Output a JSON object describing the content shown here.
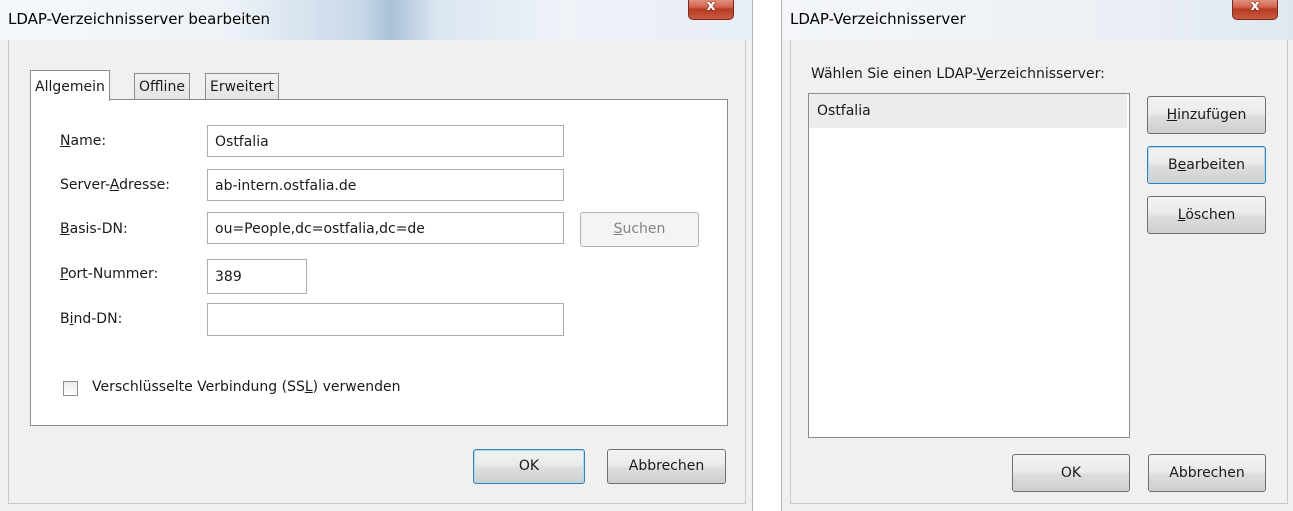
{
  "edit_dialog": {
    "title": "LDAP-Verzeichnisserver bearbeiten",
    "close_glyph": "x",
    "tabs": [
      {
        "label": "Allgemein",
        "active": true
      },
      {
        "label": "Offline",
        "active": false
      },
      {
        "label": "Erweitert",
        "active": false
      }
    ],
    "fields": {
      "name": {
        "label_u": "N",
        "label_rest": "ame:",
        "value": "Ostfalia"
      },
      "server": {
        "label_pre": "Server-",
        "label_u": "A",
        "label_rest": "dresse:",
        "value": "ab-intern.ostfalia.de"
      },
      "basedn": {
        "label_u": "B",
        "label_rest": "asis-DN:",
        "value": "ou=People,dc=ostfalia,dc=de"
      },
      "port": {
        "label_u": "P",
        "label_rest": "ort-Nummer:",
        "value": "389"
      },
      "binddn": {
        "label_pre": "B",
        "label_u": "i",
        "label_rest": "nd-DN:",
        "value": ""
      }
    },
    "search_button": {
      "label_u": "S",
      "label_rest": "uchen",
      "enabled": false
    },
    "ssl_checkbox": {
      "label_pre": "Verschlüsselte Verbindung (SS",
      "label_u": "L",
      "label_rest": ") verwenden",
      "checked": false
    },
    "ok_label": "OK",
    "cancel_label": "Abbrechen"
  },
  "server_dialog": {
    "title": "LDAP-Verzeichnisserver",
    "close_glyph": "x",
    "prompt_pre": "Wählen Sie einen LDAP-",
    "prompt_u": "V",
    "prompt_rest": "erzeichnisserver:",
    "servers": [
      "Ostfalia"
    ],
    "add_button": {
      "label_u": "H",
      "label_rest": "inzufügen"
    },
    "edit_button": {
      "label_pre": "B",
      "label_u": "e",
      "label_rest": "arbeiten"
    },
    "delete_button": {
      "label_u": "L",
      "label_rest": "öschen"
    },
    "ok_label": "OK",
    "cancel_label": "Abbrechen"
  },
  "colors": {
    "default_button_border": "#3c7fb1",
    "close_button": "#c8462f",
    "dialog_background": "#f0f0f0"
  }
}
